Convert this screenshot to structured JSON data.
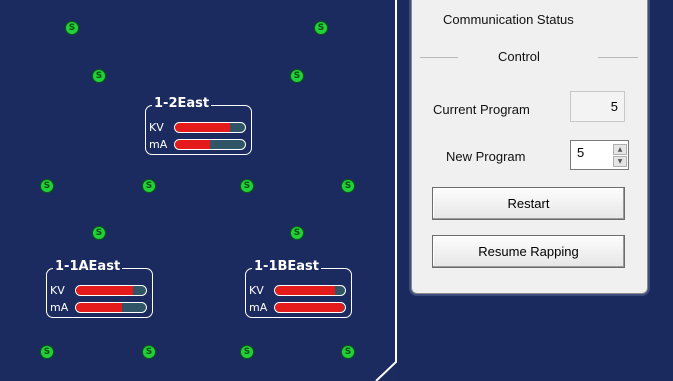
{
  "colors": {
    "background": "#1c2b5f",
    "indicator_green": "#22d03a",
    "bar_fill": "#e51b1b",
    "bar_track": "#2f5567",
    "panel_bg": "#f0f0f0"
  },
  "map": {
    "dot_symbol": "S",
    "units": [
      {
        "title": "1-2East",
        "kv_label": "KV",
        "ma_label": "mA",
        "kv_level": 0.78,
        "ma_level": 0.5
      },
      {
        "title": "1-1AEast",
        "kv_label": "KV",
        "ma_label": "mA",
        "kv_level": 0.82,
        "ma_level": 0.65
      },
      {
        "title": "1-1BEast",
        "kv_label": "KV",
        "ma_label": "mA",
        "kv_level": 0.85,
        "ma_level": 0.99
      }
    ]
  },
  "panel": {
    "comm_status_label": "Communication Status",
    "control_group_label": "Control",
    "current_program_label": "Current Program",
    "current_program_value": "5",
    "new_program_label": "New Program",
    "new_program_value": "5",
    "restart_label": "Restart",
    "resume_label": "Resume Rapping"
  }
}
